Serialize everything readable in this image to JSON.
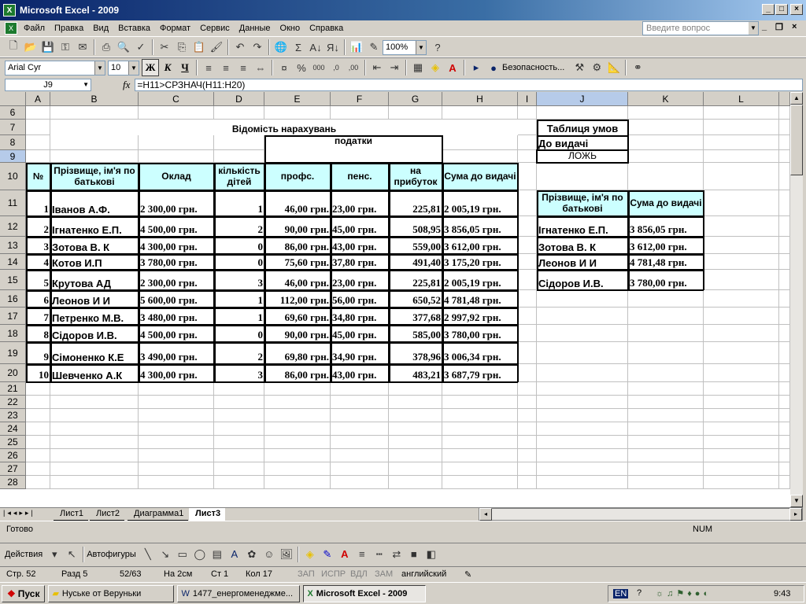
{
  "window": {
    "title": "Microsoft Excel - 2009"
  },
  "menu": [
    "Файл",
    "Правка",
    "Вид",
    "Вставка",
    "Формат",
    "Сервис",
    "Данные",
    "Окно",
    "Справка"
  ],
  "ask_placeholder": "Введите вопрос",
  "toolbar": {
    "zoom": "100%",
    "font": "Arial Cyr",
    "size": "10",
    "bold": "Ж",
    "italic": "К",
    "underline": "Ч",
    "security": "Безопасность..."
  },
  "formula_bar": {
    "cell": "J9",
    "fx": "fx",
    "formula": "=H11>СРЗНАЧ(H11:H20)"
  },
  "columns": [
    "A",
    "B",
    "C",
    "D",
    "E",
    "F",
    "G",
    "H",
    "I",
    "J",
    "K",
    "L"
  ],
  "rows": [
    "6",
    "7",
    "8",
    "9",
    "10",
    "11",
    "12",
    "13",
    "14",
    "15",
    "16",
    "17",
    "18",
    "19",
    "20",
    "21",
    "22",
    "23",
    "24",
    "25",
    "26",
    "27",
    "28"
  ],
  "sheet": {
    "title": "Відомість нарахувань",
    "taxes_header": "податки",
    "headers": {
      "num": "№",
      "name": "Прізвище, ім'я по батькові",
      "salary": "Оклад",
      "children": "кількість дітей",
      "prof": "профс.",
      "pens": "пенс.",
      "income": "на прибуток",
      "total": "Сума до видачі"
    },
    "employees": [
      {
        "n": "1",
        "name": "Іванов А.Ф.",
        "salary": "2 300,00 грн.",
        "children": "1",
        "prof": "46,00 грн.",
        "pens": "23,00 грн.",
        "income": "225,81",
        "total": "2 005,19 грн."
      },
      {
        "n": "2",
        "name": "Ігнатенко Е.П.",
        "salary": "4 500,00 грн.",
        "children": "2",
        "prof": "90,00 грн.",
        "pens": "45,00 грн.",
        "income": "508,95",
        "total": "3 856,05 грн."
      },
      {
        "n": "3",
        "name": "Зотова В. К",
        "salary": "4 300,00 грн.",
        "children": "0",
        "prof": "86,00 грн.",
        "pens": "43,00 грн.",
        "income": "559,00",
        "total": "3 612,00 грн."
      },
      {
        "n": "4",
        "name": "Котов И.П",
        "salary": "3 780,00 грн.",
        "children": "0",
        "prof": "75,60 грн.",
        "pens": "37,80 грн.",
        "income": "491,40",
        "total": "3 175,20 грн."
      },
      {
        "n": "5",
        "name": "Крутова АД",
        "salary": "2 300,00 грн.",
        "children": "3",
        "prof": "46,00 грн.",
        "pens": "23,00 грн.",
        "income": "225,81",
        "total": "2 005,19 грн."
      },
      {
        "n": "6",
        "name": "Леонов И И",
        "salary": "5 600,00 грн.",
        "children": "1",
        "prof": "112,00 грн.",
        "pens": "56,00 грн.",
        "income": "650,52",
        "total": "4 781,48 грн."
      },
      {
        "n": "7",
        "name": "Петренко М.В.",
        "salary": "3 480,00 грн.",
        "children": "1",
        "prof": "69,60 грн.",
        "pens": "34,80 грн.",
        "income": "377,68",
        "total": "2 997,92 грн."
      },
      {
        "n": "8",
        "name": "Сідоров И.В.",
        "salary": "4 500,00 грн.",
        "children": "0",
        "prof": "90,00 грн.",
        "pens": "45,00 грн.",
        "income": "585,00",
        "total": "3 780,00 грн."
      },
      {
        "n": "9",
        "name": "Сімоненко К.Е",
        "salary": "3 490,00 грн.",
        "children": "2",
        "prof": "69,80 грн.",
        "pens": "34,90 грн.",
        "income": "378,96",
        "total": "3 006,34 грн."
      },
      {
        "n": "10",
        "name": "Шевченко А.К",
        "salary": "4 300,00 грн.",
        "children": "3",
        "prof": "86,00 грн.",
        "pens": "43,00 грн.",
        "income": "483,21",
        "total": "3 687,79 грн."
      }
    ],
    "conditions": {
      "title": "Таблиця умов",
      "label": "До видачі",
      "value": "ЛОЖЬ"
    },
    "filtered": {
      "headers": {
        "name": "Прізвище, ім'я по батькові",
        "total": "Сума до видачі"
      },
      "rows": [
        {
          "name": "Ігнатенко Е.П.",
          "total": "3 856,05 грн."
        },
        {
          "name": "Зотова В. К",
          "total": "3 612,00 грн."
        },
        {
          "name": "Леонов И И",
          "total": "4 781,48 грн."
        },
        {
          "name": "Сідоров И.В.",
          "total": "3 780,00 грн."
        }
      ]
    }
  },
  "tabs": [
    "Лист1",
    "Лист2",
    "Диаграмма1",
    "Лист3"
  ],
  "status": {
    "ready": "Готово",
    "num": "NUM"
  },
  "drawing": {
    "actions": "Действия",
    "autoshapes": "Автофигуры"
  },
  "word_status": [
    "Стр. 52",
    "Разд 5",
    "52/63",
    "На 2см",
    "Ст 1",
    "Кол 17",
    "ЗАП",
    "ИСПР",
    "ВДЛ",
    "ЗАМ",
    "английский"
  ],
  "taskbar": {
    "start": "Пуск",
    "tasks": [
      "Нуське от Веруньки",
      "1477_енергоменеджме...",
      "Microsoft Excel - 2009"
    ],
    "lang": "EN",
    "time": "9:43"
  }
}
